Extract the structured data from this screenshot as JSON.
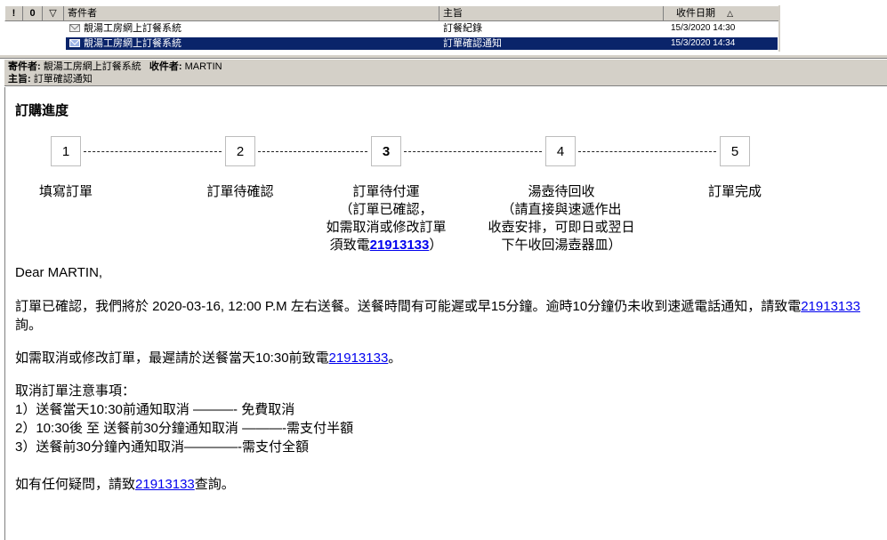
{
  "list": {
    "columns": {
      "importance": "!",
      "attachment": "0",
      "flag": "▽",
      "sender": "寄件者",
      "subject": "主旨",
      "received": "收件日期",
      "sort_indicator": "△"
    },
    "rows": [
      {
        "sender": "靚湯工房網上訂餐系統",
        "subject": "訂餐紀錄",
        "received": "15/3/2020 14:30"
      },
      {
        "sender": "靚湯工房網上訂餐系統",
        "subject": "訂單確認通知",
        "received": "15/3/2020 14:34"
      }
    ]
  },
  "preview": {
    "from_label": "寄件者:",
    "from": "靚湯工房網上訂餐系統",
    "to_label": "收件者:",
    "to": "MARTIN",
    "subject_label": "主旨:",
    "subject": "訂單確認通知"
  },
  "email": {
    "title": "訂購進度",
    "steps": [
      {
        "num": "1",
        "label": "填寫訂單"
      },
      {
        "num": "2",
        "label": "訂單待確認"
      },
      {
        "num": "3",
        "label": "訂單待付運",
        "note1": "（訂單已確認，",
        "note2": "如需取消或修改訂單",
        "note3_pre": "須致電",
        "phone": "21913133",
        "note3_post": "）"
      },
      {
        "num": "4",
        "label": "湯壺待回收",
        "note1": "（請直接與速遞作出",
        "note2": "收壺安排，可即日或翌日",
        "note3": "下午收回湯壺器皿）"
      },
      {
        "num": "5",
        "label": "訂單完成"
      }
    ],
    "greeting": "Dear MARTIN,",
    "p1_line1": "訂單已確認，我們將於 2020-03-16, 12:00 P.M 左右送餐。送餐時間有可能遲或早15分鐘。逾時10分鐘仍未收到速遞電話通知，請致電",
    "p1_phone": "21913133",
    "p1_line2": "詢。",
    "p2_pre": "如需取消或修改訂單，最遲請於送餐當天10:30前致電",
    "p2_phone": "21913133",
    "p2_post": "。",
    "notice_title": "取消訂單注意事項：",
    "notice": [
      "1）送餐當天10:30前通知取消 ———- 免費取消",
      "2）10:30後 至 送餐前30分鐘通知取消 ———-需支付半額",
      "3）送餐前30分鐘內通知取消————-需支付全額"
    ],
    "contact_pre": "如有任何疑問，請致",
    "contact_phone": "21913133",
    "contact_post": "查詢。"
  }
}
